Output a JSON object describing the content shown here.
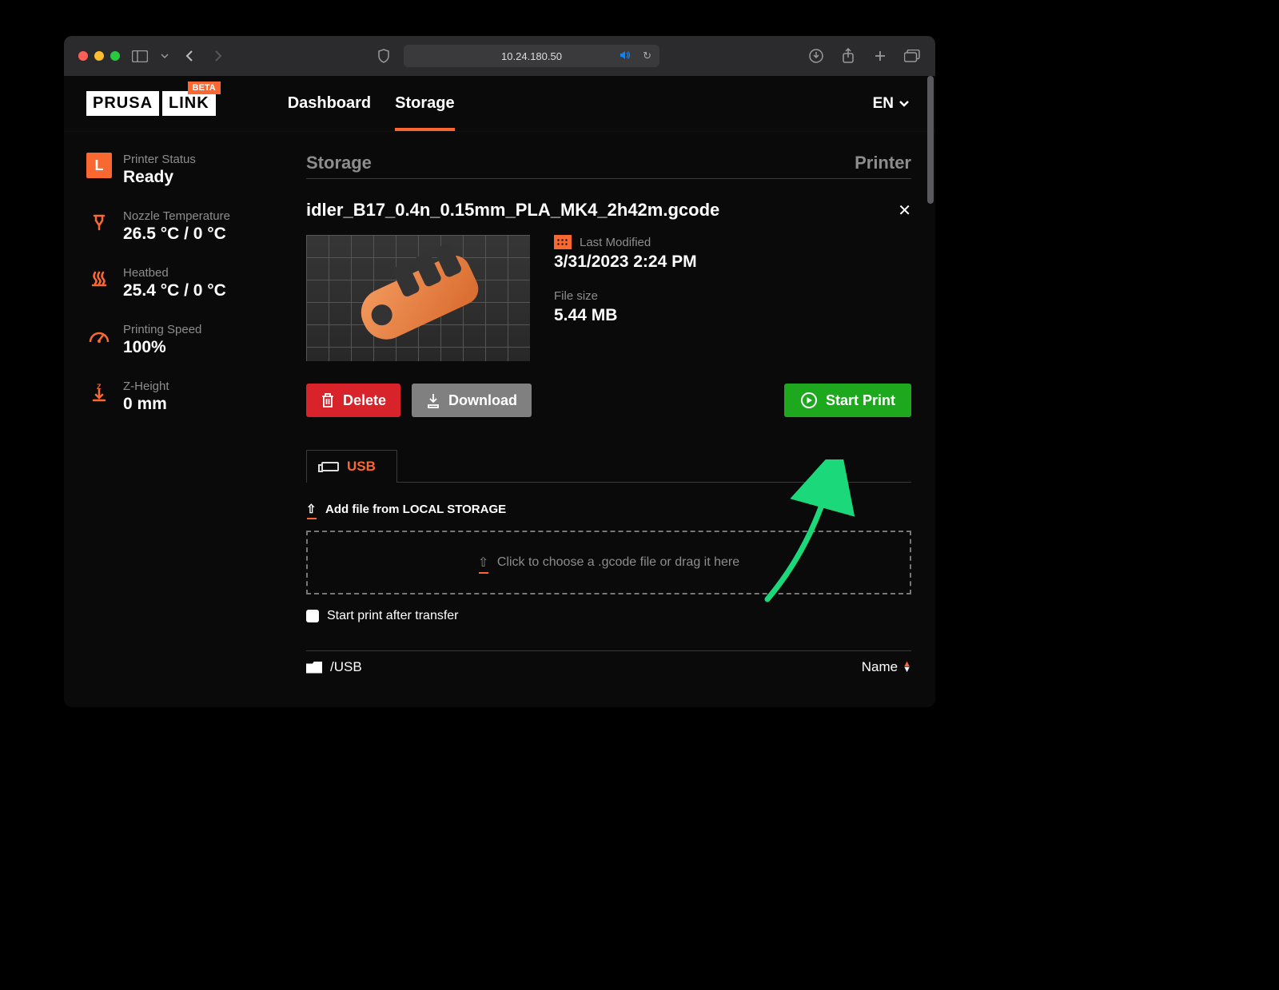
{
  "browser": {
    "address": "10.24.180.50"
  },
  "nav": {
    "logo_left": "PRUSA",
    "logo_right": "LINK",
    "beta": "BETA",
    "tabs": {
      "dashboard": "Dashboard",
      "storage": "Storage"
    },
    "lang": "EN"
  },
  "sidebar": {
    "badge": "L",
    "status_label": "Printer Status",
    "status_value": "Ready",
    "nozzle_label": "Nozzle Temperature",
    "nozzle_value": "26.5 °C / 0 °C",
    "bed_label": "Heatbed",
    "bed_value": "25.4 °C / 0 °C",
    "speed_label": "Printing Speed",
    "speed_value": "100%",
    "z_label": "Z-Height",
    "z_value": "0 mm"
  },
  "main": {
    "heading_left": "Storage",
    "heading_right": "Printer",
    "file_name": "idler_B17_0.4n_0.15mm_PLA_MK4_2h42m.gcode",
    "modified_label": "Last Modified",
    "modified_value": "3/31/2023 2:24 PM",
    "size_label": "File size",
    "size_value": "5.44 MB",
    "delete": "Delete",
    "download": "Download",
    "start": "Start Print",
    "tab_usb": "USB",
    "addfile": "Add file from LOCAL STORAGE",
    "dropzone": "Click to choose a .gcode file or drag it here",
    "checkbox": "Start print after transfer",
    "path": "/USB",
    "sort_label": "Name"
  }
}
